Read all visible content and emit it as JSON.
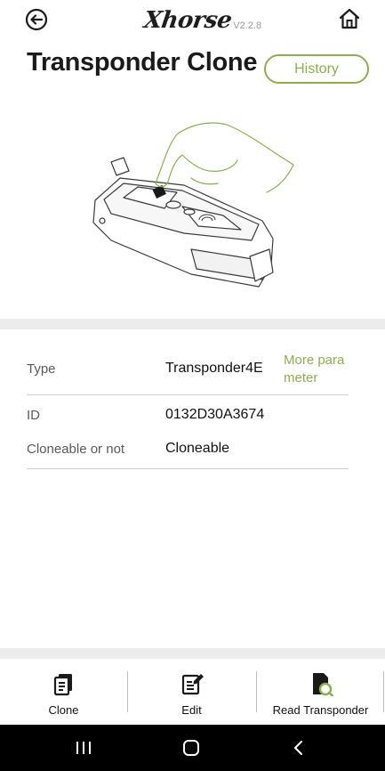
{
  "header": {
    "logo_text": "Xhorse",
    "version": "V2.2.8"
  },
  "page": {
    "title": "Transponder Clone",
    "history_label": "History"
  },
  "info": {
    "type_label": "Type",
    "type_value": "Transponder4E",
    "more_link": "More parameter",
    "id_label": "ID",
    "id_value": "0132D30A3674",
    "cloneable_label": "Cloneable or not",
    "cloneable_value": "Cloneable"
  },
  "bottom_actions": {
    "clone_label": "Clone",
    "edit_label": "Edit",
    "read_label": "Read Transponder"
  },
  "colors": {
    "accent": "#8ab04e",
    "band": "#ececec",
    "navbar": "#000000"
  },
  "icons": {
    "back": "back-arrow-circle-icon",
    "home": "home-icon",
    "clone": "clone-icon",
    "edit": "edit-icon",
    "read": "read-transponder-icon"
  }
}
